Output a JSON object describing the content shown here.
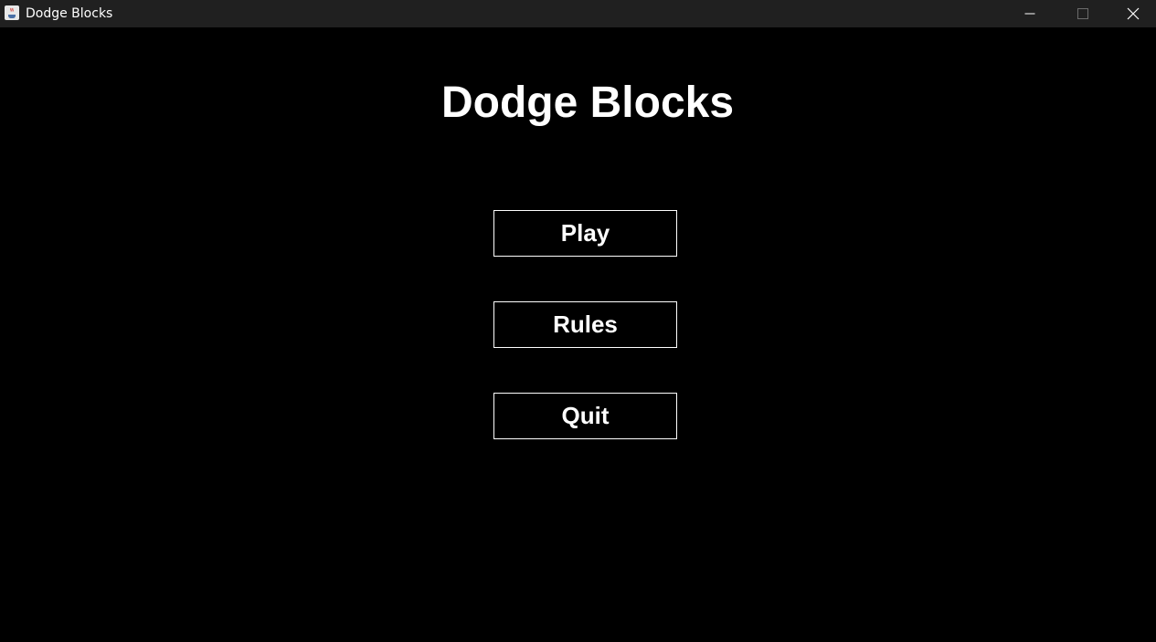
{
  "window": {
    "title": "Dodge Blocks",
    "controls": {
      "minimize_icon": "minimize-icon",
      "maximize_icon": "maximize-icon",
      "close_icon": "close-icon"
    }
  },
  "game": {
    "title": "Dodge Blocks",
    "menu": {
      "play_label": "Play",
      "rules_label": "Rules",
      "quit_label": "Quit"
    }
  },
  "colors": {
    "background": "#000000",
    "titlebar": "#202020",
    "text": "#ffffff",
    "button_border": "#ffffff"
  }
}
